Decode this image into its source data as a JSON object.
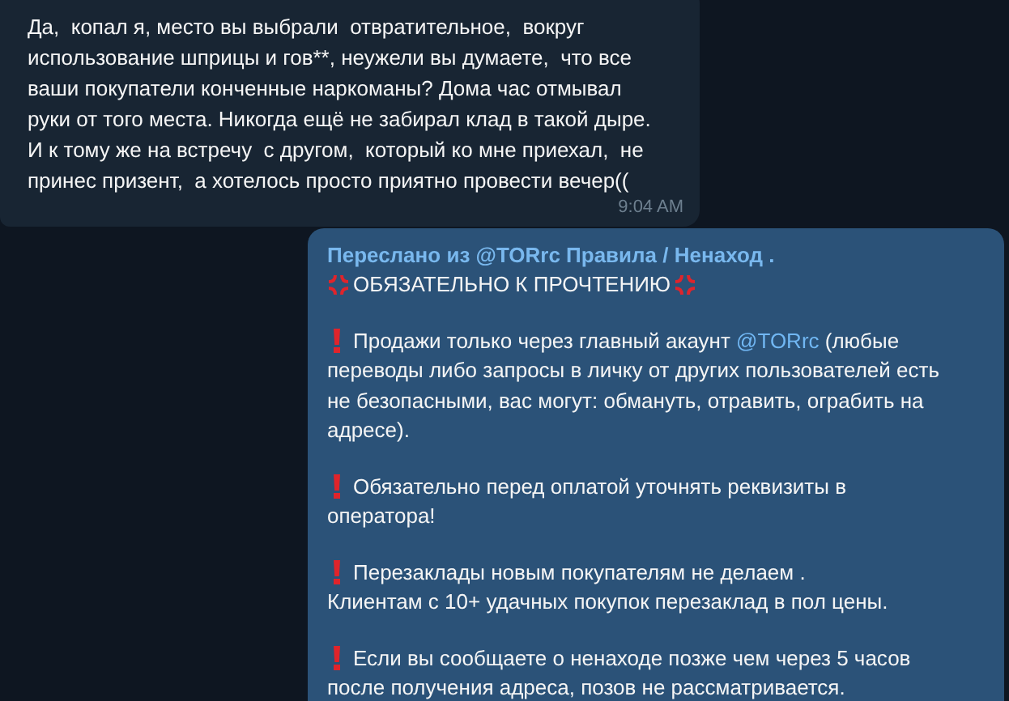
{
  "incoming_message": {
    "lines": [
      "Да,  копал я, место вы выбрали  отвратительное,  вокруг",
      "использование шприцы и гов**, неужели вы думаете,  что все",
      "ваши покупатели конченные наркоманы? Дома час отмывал",
      "руки от того места. Никогда ещё не забирал клад в такой дыре.",
      "И к тому же на встречу  с другом,  который ко мне приехал,  не",
      "принес призент,  а хотелось просто приятно провести вечер(("
    ],
    "time": "9:04 AM"
  },
  "forwarded_message": {
    "header": "Переслано из @TORrc Правила / Ненаход .",
    "title": "ОБЯЗАТЕЛЬНО К ПРОЧТЕНИЮ",
    "rules": [
      {
        "lines": [
          [
            {
              "kind": "text",
              "text": "Продажи только через главный акаунт "
            },
            {
              "kind": "link",
              "text": "@TORrc"
            },
            {
              "kind": "text",
              "text": " (любые"
            }
          ],
          [
            {
              "kind": "text",
              "text": "переводы либо запросы в личку от других пользователей есть"
            }
          ],
          [
            {
              "kind": "text",
              "text": "не безопасными, вас могут: обмануть, отравить, ограбить на"
            }
          ],
          [
            {
              "kind": "text",
              "text": "адресе)."
            }
          ]
        ]
      },
      {
        "lines": [
          [
            {
              "kind": "text",
              "text": "Обязательно перед оплатой уточнять реквизиты в"
            }
          ],
          [
            {
              "kind": "text",
              "text": "оператора!"
            }
          ]
        ]
      },
      {
        "lines": [
          [
            {
              "kind": "text",
              "text": "Перезаклады новым покупателям не делаем ."
            }
          ],
          [
            {
              "kind": "text",
              "text": "Клиентам с 10+ удачных покупок перезаклад в пол цены."
            }
          ]
        ]
      },
      {
        "lines": [
          [
            {
              "kind": "text",
              "text": "Если вы сообщаете о ненаходе позже чем через 5 часов"
            }
          ],
          [
            {
              "kind": "text",
              "text": "после получения адреса, позов не рассматривается."
            }
          ]
        ]
      }
    ]
  }
}
